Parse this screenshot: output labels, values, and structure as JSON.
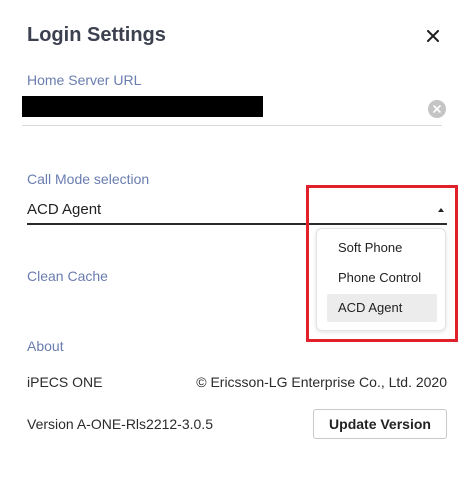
{
  "dialog": {
    "title": "Login Settings",
    "close_icon": "close-icon"
  },
  "home_server": {
    "label": "Home Server URL",
    "value": "",
    "value_redacted": true,
    "clear_icon": "clear-circle-icon"
  },
  "call_mode": {
    "label": "Call Mode selection",
    "selected": "ACD Agent",
    "caret_icon": "caret-up-icon",
    "options": [
      {
        "label": "Soft Phone"
      },
      {
        "label": "Phone Control"
      },
      {
        "label": "ACD Agent"
      }
    ]
  },
  "clean_cache": {
    "label": "Clean Cache"
  },
  "about": {
    "label": "About",
    "product": "iPECS ONE",
    "copyright": "© Ericsson-LG Enterprise Co., Ltd. 2020",
    "version": "Version A-ONE-Rls2212-3.0.5",
    "update_button": "Update Version"
  },
  "colors": {
    "label_blue": "#6a7db0",
    "title": "#3c4150",
    "highlight_red": "#e0202a",
    "selected_option_bg": "#ececec"
  }
}
